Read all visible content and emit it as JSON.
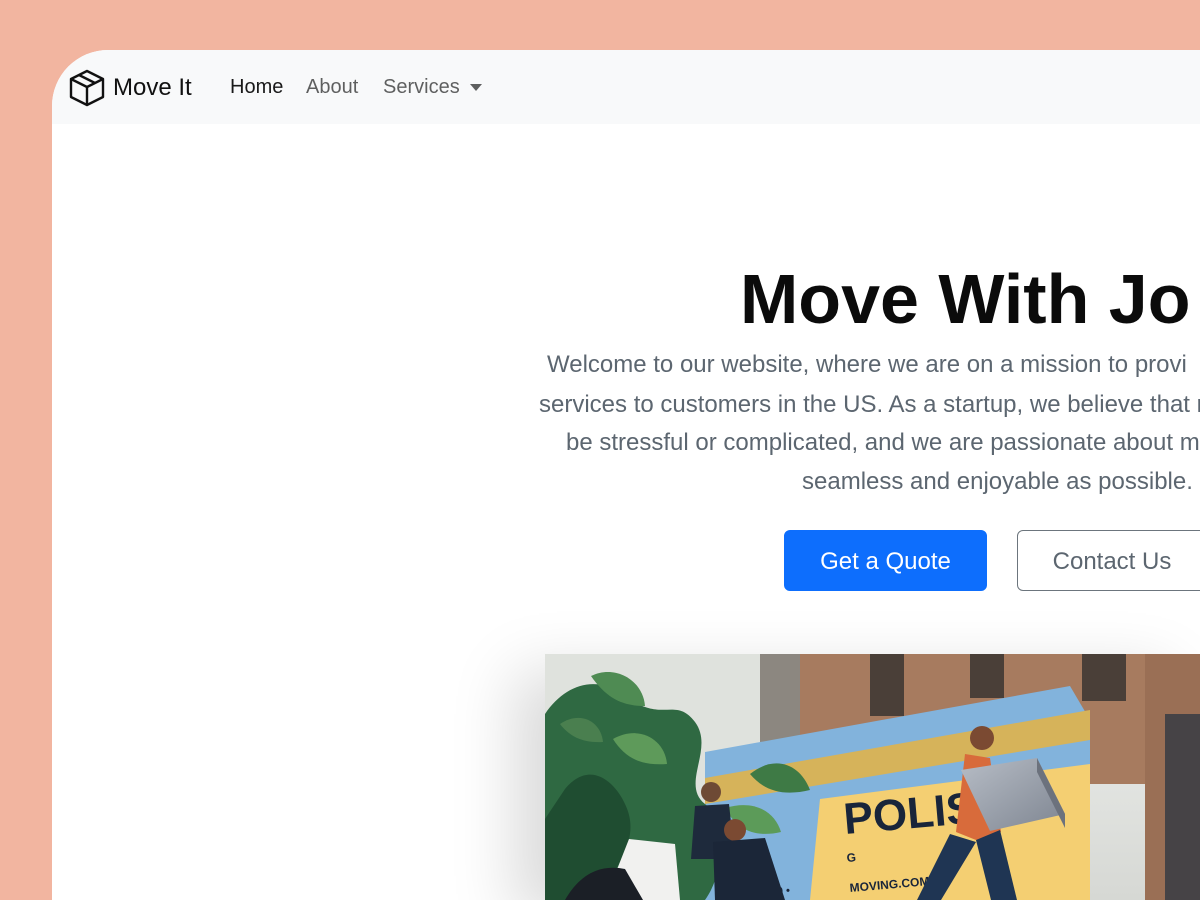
{
  "navbar": {
    "brand": {
      "icon": "box-icon",
      "name": "Move It"
    },
    "links": [
      {
        "label": "Home"
      },
      {
        "label": "About"
      },
      {
        "label": "Services",
        "icon": "chevron-down-icon"
      }
    ]
  },
  "hero": {
    "title": "Move With Jo",
    "description_lines": [
      "Welcome to our website, where we are on a mission to provi",
      "services to customers in the US. As a startup, we believe that r",
      "be stressful or complicated, and we are passionate about m",
      "seamless and enjoyable as possible."
    ],
    "buttons": {
      "primary": "Get a Quote",
      "secondary": "Contact Us"
    },
    "colors": {
      "accent": "#0d6efd",
      "page_bg": "#f2b5a0",
      "navbar_bg": "#f8f9fa"
    }
  },
  "hero_image": {
    "truck_text": "POLIS",
    "truck_subtext": "G",
    "website_text": "MOVING.COM",
    "truck_small_text": "520 •"
  }
}
